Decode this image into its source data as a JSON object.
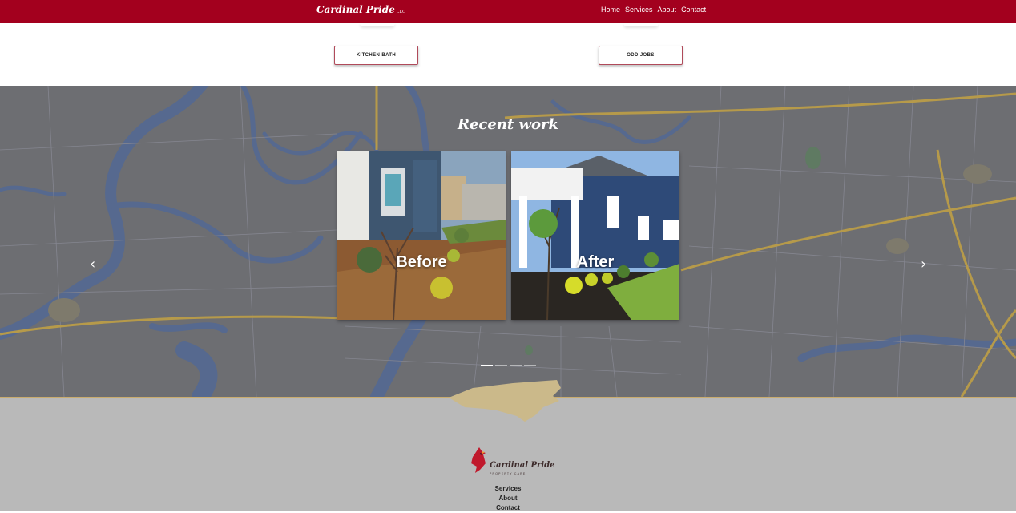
{
  "header": {
    "brand": "Cardinal Pride",
    "brand_suffix": "LLC",
    "nav": [
      "Home",
      "Services",
      "About",
      "Contact"
    ],
    "bg_color": "#a3001e"
  },
  "services": {
    "buttons": [
      "KITCHEN BATH",
      "ODD JOBS"
    ]
  },
  "recent_work": {
    "title": "Recent work",
    "slides": [
      {
        "label": "Before"
      },
      {
        "label": "After"
      }
    ],
    "prev_icon": "chevron-left-icon",
    "next_icon": "chevron-right-icon",
    "prev_glyph": "‹",
    "next_glyph": "›",
    "slide_count": 4,
    "active_slide": 1
  },
  "footer": {
    "logo_text": "Cardinal Pride",
    "logo_sub": "PROPERTY CARE",
    "links": [
      "Services",
      "About",
      "Contact"
    ],
    "accent_color": "#c9ac6e"
  }
}
